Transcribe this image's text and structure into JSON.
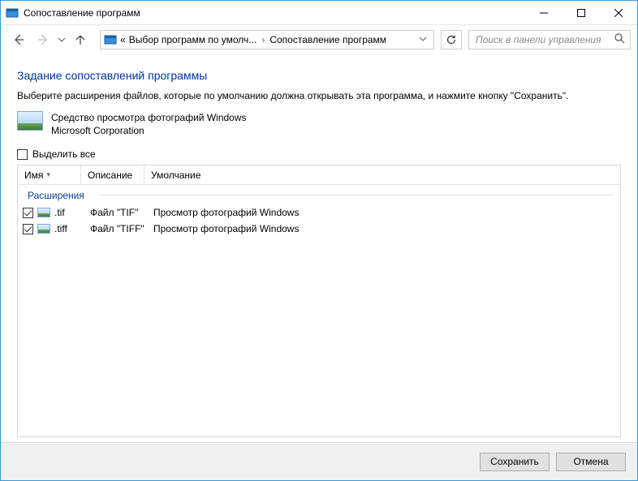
{
  "titlebar": {
    "title": "Сопоставление программ"
  },
  "breadcrumb": {
    "prefix": "«",
    "parent": "Выбор программ по умолч...",
    "current": "Сопоставление программ"
  },
  "search": {
    "placeholder": "Поиск в панели управления"
  },
  "page": {
    "heading": "Задание сопоставлений программы",
    "description": "Выберите расширения файлов, которые по умолчанию должна открывать эта программа, и нажмите кнопку \"Сохранить\"."
  },
  "app": {
    "name": "Средство просмотра фотографий Windows",
    "publisher": "Microsoft Corporation"
  },
  "select_all_label": "Выделить все",
  "columns": {
    "name": "Имя",
    "description": "Описание",
    "default": "Умолчание"
  },
  "group_label": "Расширения",
  "rows": [
    {
      "checked": true,
      "ext": ".tif",
      "desc": "Файл \"TIF\"",
      "default": "Просмотр фотографий Windows"
    },
    {
      "checked": true,
      "ext": ".tiff",
      "desc": "Файл \"TIFF\"",
      "default": "Просмотр фотографий Windows"
    }
  ],
  "buttons": {
    "save": "Сохранить",
    "cancel": "Отмена"
  }
}
